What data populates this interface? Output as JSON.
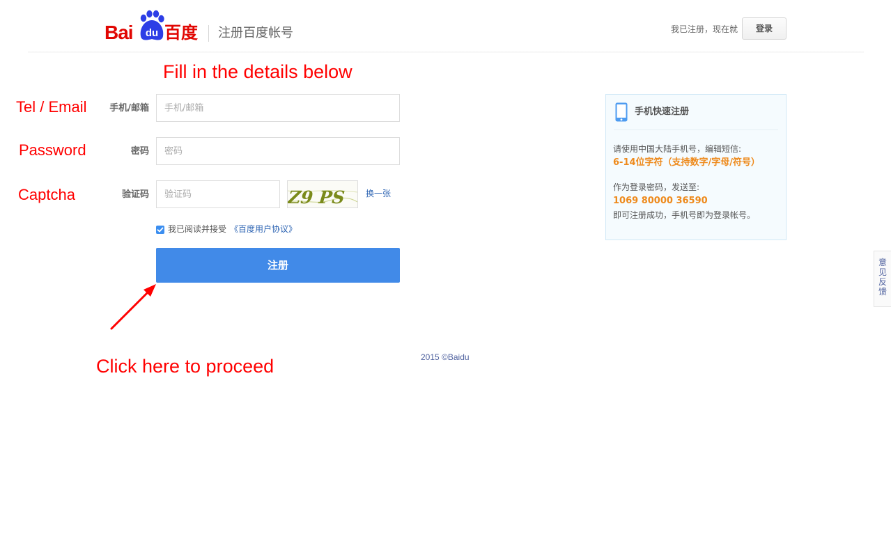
{
  "header": {
    "logo_text_latin": "Bai",
    "logo_text_paw": "du",
    "logo_text_cn": "百度",
    "title": "注册百度帐号",
    "login_hint": "我已注册，现在就",
    "login_button": "登录"
  },
  "annotations": {
    "top_instruction": "Fill in the details below",
    "tel_email": "Tel / Email",
    "password": "Password",
    "captcha": "Captcha",
    "click_here": "Click here to proceed"
  },
  "form": {
    "phone_email": {
      "label": "手机/邮箱",
      "placeholder": "手机/邮箱",
      "value": ""
    },
    "password": {
      "label": "密码",
      "placeholder": "密码",
      "value": ""
    },
    "captcha": {
      "label": "验证码",
      "placeholder": "验证码",
      "value": "",
      "image_text": "Z9 PS",
      "refresh_label": "换一张"
    },
    "agreement": {
      "checked": true,
      "text": "我已阅读并接受",
      "link": "《百度用户协议》"
    },
    "submit_label": "注册"
  },
  "sms_panel": {
    "icon": "mobile-phone-icon",
    "title": "手机快速注册",
    "line1": "请使用中国大陆手机号，编辑短信:",
    "highlight1": "6-14位字符（支持数字/字母/符号）",
    "line2": "作为登录密码，发送至:",
    "highlight2": "1069 80000 36590",
    "line3": "即可注册成功，手机号即为登录帐号。"
  },
  "footer": {
    "copyright": "2015 ©Baidu"
  },
  "feedback": {
    "label": "意见反馈"
  },
  "colors": {
    "brand_red": "#e10602",
    "brand_blue": "#2d3ee6",
    "submit_blue": "#418ae8",
    "annotation_red": "#ff0000",
    "highlight_orange": "#ee8a1c",
    "link_blue": "#2d64b3"
  }
}
